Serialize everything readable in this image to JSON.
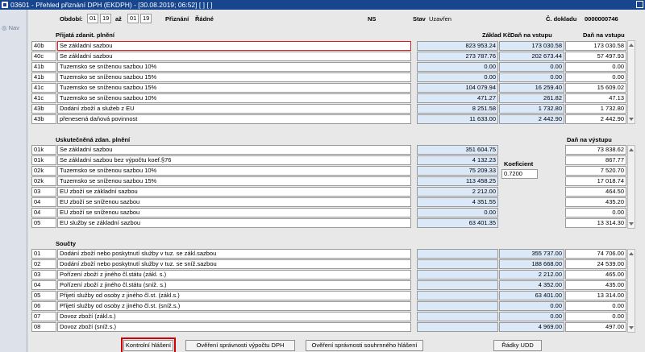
{
  "title": "03601 - Přehled přiznání DPH (EKDPH) - [30.08.2019; 06:52] [ ] [ ]",
  "nav": "Nav",
  "header": {
    "obdobi_label": "Období:",
    "from_month": "01",
    "from_year": "19",
    "az": "až",
    "to_month": "01",
    "to_year": "19",
    "priznani_label": "Přiznání",
    "priznani_value": "Řádné",
    "ns": "NS",
    "stav_label": "Stav",
    "stav_value": "Uzavřen",
    "cdokladu_label": "Č. dokladu",
    "cdokladu_value": "0000000746"
  },
  "section1": {
    "title": "Přijatá zdanit. plnění",
    "col_base": "Základ Kč",
    "col_vstup1": "Daň na vstupu",
    "col_vstup2": "Daň na vstupu",
    "rows": [
      {
        "code": "40b",
        "desc": "Se základní sazbou",
        "base": "823 953.24",
        "d1": "173 030.58",
        "d2": "173 030.58"
      },
      {
        "code": "40c",
        "desc": "Se základní sazbou",
        "base": "273 787.76",
        "d1": "202 673.44",
        "d2": "57 497.93"
      },
      {
        "code": "41b",
        "desc": "Tuzemsko se sníženou sazbou 10%",
        "base": "0.00",
        "d1": "0.00",
        "d2": "0.00"
      },
      {
        "code": "41b",
        "desc": "Tuzemsko se sníženou sazbou 15%",
        "base": "0.00",
        "d1": "0.00",
        "d2": "0.00"
      },
      {
        "code": "41c",
        "desc": "Tuzemsko se sníženou sazbou 15%",
        "base": "104 079.94",
        "d1": "16 259.40",
        "d2": "15 609.02"
      },
      {
        "code": "41c",
        "desc": "Tuzemsko se sníženou sazbou 10%",
        "base": "471.27",
        "d1": "261.82",
        "d2": "47.13"
      },
      {
        "code": "43b",
        "desc": "Dodání zboží a služeb z EU",
        "base": "8 251.58",
        "d1": "1 732.80",
        "d2": "1 732.80"
      },
      {
        "code": "43b",
        "desc": "přenesená daňová povinnost",
        "base": "11 633.00",
        "d1": "2 442.90",
        "d2": "2 442.90"
      }
    ]
  },
  "section2": {
    "title": "Uskutečněná zdan. plnění",
    "col_vystup": "Daň na výstupu",
    "koef_label": "Koeficient",
    "koef_value": "0.7200",
    "rows": [
      {
        "code": "01k",
        "desc": "Se základní sazbou",
        "base": "351 604.75",
        "d": "73 838.62"
      },
      {
        "code": "01k",
        "desc": "Se základní sazbou bez výpočtu koef.§76",
        "base": "4 132.23",
        "d": "867.77"
      },
      {
        "code": "02k",
        "desc": "Tuzemsko se sníženou sazbou 10%",
        "base": "75 209.33",
        "d": "7 520.70"
      },
      {
        "code": "02k",
        "desc": "Tuzemsko se sníženou sazbou 15%",
        "base": "113 458.25",
        "d": "17 018.74"
      },
      {
        "code": "03",
        "desc": "EU zboží se základní sazbou",
        "base": "2 212.00",
        "d": "464.50"
      },
      {
        "code": "04",
        "desc": "EU zboží se sníženou sazbou",
        "base": "4 351.55",
        "d": "435.20"
      },
      {
        "code": "04",
        "desc": "EU zboží se sníženou sazbou",
        "base": "0.00",
        "d": "0.00"
      },
      {
        "code": "05",
        "desc": "EU služby se základní sazbou",
        "base": "63 401.35",
        "d": "13 314.30"
      }
    ]
  },
  "section3": {
    "title": "Součty",
    "rows": [
      {
        "code": "01",
        "desc": "Dodání zboží nebo poskytnutí služby v tuz. se zákl.sazbou",
        "v1": "355 737.00",
        "v2": "74 706.00"
      },
      {
        "code": "02",
        "desc": "Dodání zboží nebo poskytnutí služby v tuz. se sníž.sazbou",
        "v1": "188 668.00",
        "v2": "24 539.00"
      },
      {
        "code": "03",
        "desc": "Pořízení zboží z jiného čl.státu (zákl. s.)",
        "v1": "2 212.00",
        "v2": "465.00"
      },
      {
        "code": "04",
        "desc": "Pořízení zboží z jiného čl.státu (sníž. s.)",
        "v1": "4 352.00",
        "v2": "435.00"
      },
      {
        "code": "05",
        "desc": "Přijetí služby od osoby z jiného čl.st. (zákl.s.)",
        "v1": "63 401.00",
        "v2": "13 314.00"
      },
      {
        "code": "06",
        "desc": "Přijetí služby od osoby z jiného čl.st. (sníž.s.)",
        "v1": "0.00",
        "v2": "0.00"
      },
      {
        "code": "07",
        "desc": "Dovoz zboží (zákl.s.)",
        "v1": "0.00",
        "v2": "0.00"
      },
      {
        "code": "08",
        "desc": "Dovoz zboží (sníž.s.)",
        "v1": "4 969.00",
        "v2": "497.00"
      }
    ]
  },
  "buttons": {
    "kontrolni": "Kontrolní hlášení",
    "overeni_dph": "Ověření správnosti výpočtu DPH",
    "overeni_souhrn": "Ověření správnosti souhrnného hlášení",
    "radky": "Řádky UDD"
  }
}
